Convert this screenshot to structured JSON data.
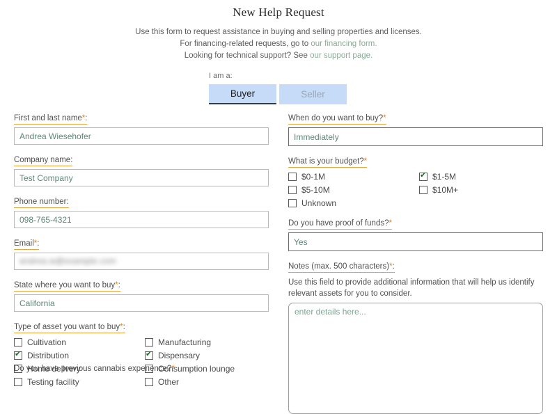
{
  "header": {
    "title": "New Help Request",
    "intro_line1": "Use this form to request assistance in buying and selling properties and licenses.",
    "intro_line2_prefix": "For financing-related requests, go to ",
    "intro_line2_link": "our financing form.",
    "intro_line3_prefix": "Looking for technical support? See ",
    "intro_line3_link": "our support page."
  },
  "role_selector": {
    "label": "I am a:",
    "tabs": [
      {
        "label": "Buyer",
        "selected": true
      },
      {
        "label": "Seller",
        "selected": false
      }
    ]
  },
  "left_column": {
    "name": {
      "label": "First and last name",
      "required": "*",
      "colon": ":",
      "value": "Andrea Wiesehofer"
    },
    "company": {
      "label": "Company name",
      "required": "",
      "colon": ":",
      "value": "Test Company"
    },
    "phone": {
      "label": "Phone number",
      "required": "",
      "colon": ":",
      "value": "098-765-4321"
    },
    "email": {
      "label": "Email",
      "required": "*",
      "colon": ":",
      "value": "andrea.w@example.com"
    },
    "state": {
      "label": "State where you want to buy",
      "required": "*",
      "colon": ":",
      "value": "California"
    },
    "asset_type": {
      "label": "Type of asset you want to buy",
      "required": "*",
      "colon": ":",
      "options": [
        {
          "label": "Cultivation",
          "checked": false
        },
        {
          "label": "Manufacturing",
          "checked": false
        },
        {
          "label": "Distribution",
          "checked": true
        },
        {
          "label": "Dispensary",
          "checked": true
        },
        {
          "label": "Home delivery",
          "checked": false
        },
        {
          "label": "Consumption lounge",
          "checked": false
        },
        {
          "label": "Testing facility",
          "checked": false
        },
        {
          "label": "Other",
          "checked": false
        }
      ]
    },
    "cannabis_experience": {
      "label": "Do you have previous cannabis experience?",
      "required": "*"
    }
  },
  "right_column": {
    "timeline": {
      "label": "When do you want to buy?",
      "required": "*",
      "colon": "",
      "value": "Immediately"
    },
    "budget": {
      "label": "What is your budget?",
      "required": "*",
      "colon": "",
      "options": [
        {
          "label": "$0-1M",
          "checked": false
        },
        {
          "label": "$1-5M",
          "checked": true
        },
        {
          "label": "$5-10M",
          "checked": false
        },
        {
          "label": "$10M+",
          "checked": false
        },
        {
          "label": "Unknown",
          "checked": false
        }
      ]
    },
    "proof_of_funds": {
      "label": "Do you have proof of funds?",
      "required": "*",
      "colon": "",
      "value": "Yes"
    },
    "notes": {
      "label": "Notes (max. 500 characters)",
      "required": "*",
      "colon": ":",
      "help_text": "Use this field to provide additional information that will help us identify relevant assets for you to consider.",
      "placeholder": "enter details here...",
      "value": ""
    }
  },
  "colors": {
    "link": "#8aab95",
    "label_underline": "#e8a33d",
    "required_asterisk": "#d9822b",
    "tab_background": "#c5dbf7",
    "input_text": "#5e8577",
    "check_mark": "#16661f"
  }
}
